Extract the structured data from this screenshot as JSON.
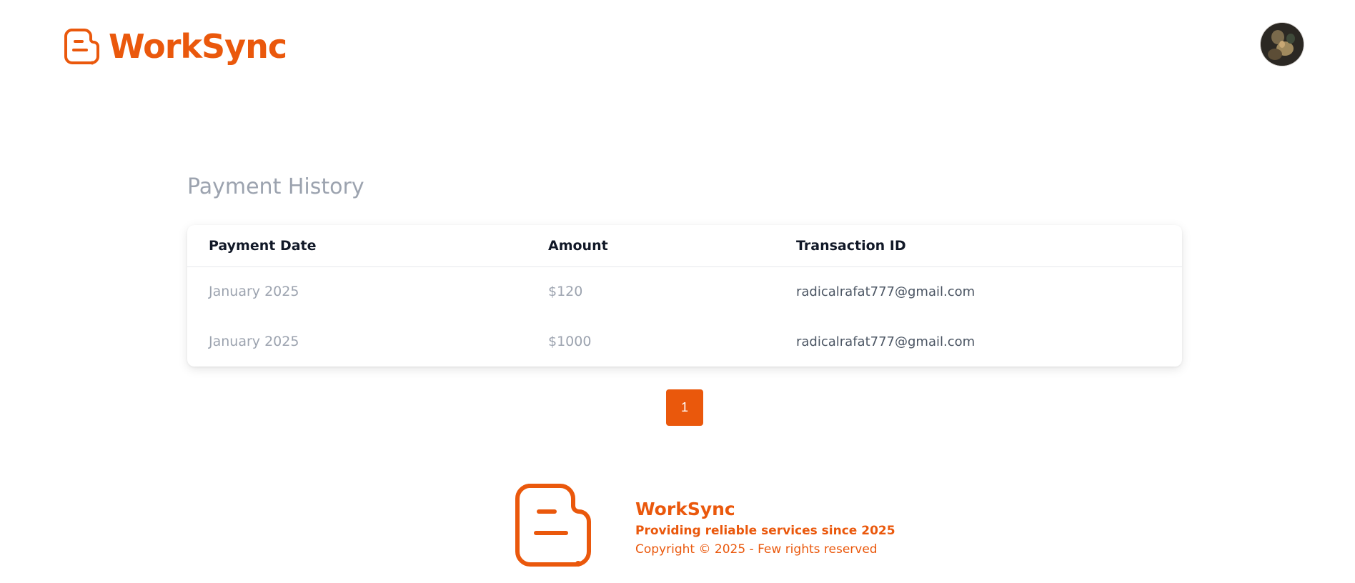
{
  "header": {
    "brand_name": "WorkSync",
    "logo_icon": "document-chat-icon",
    "avatar_alt": "user avatar"
  },
  "main": {
    "title": "Payment History",
    "table": {
      "columns": [
        "Payment Date",
        "Amount",
        "Transaction ID"
      ],
      "rows": [
        {
          "date": "January 2025",
          "amount": "$120",
          "transaction_id": "radicalrafat777@gmail.com"
        },
        {
          "date": "January 2025",
          "amount": "$1000",
          "transaction_id": "radicalrafat777@gmail.com"
        }
      ]
    },
    "pagination": {
      "pages": [
        "1"
      ],
      "current": "1"
    }
  },
  "footer": {
    "name": "WorkSync",
    "tagline": "Providing reliable services since 2025",
    "copyright": "Copyright © 2025 - Few rights reserved"
  },
  "colors": {
    "brand": "#ea580c",
    "muted_text": "#9ca3af",
    "heading_text": "#111827"
  }
}
